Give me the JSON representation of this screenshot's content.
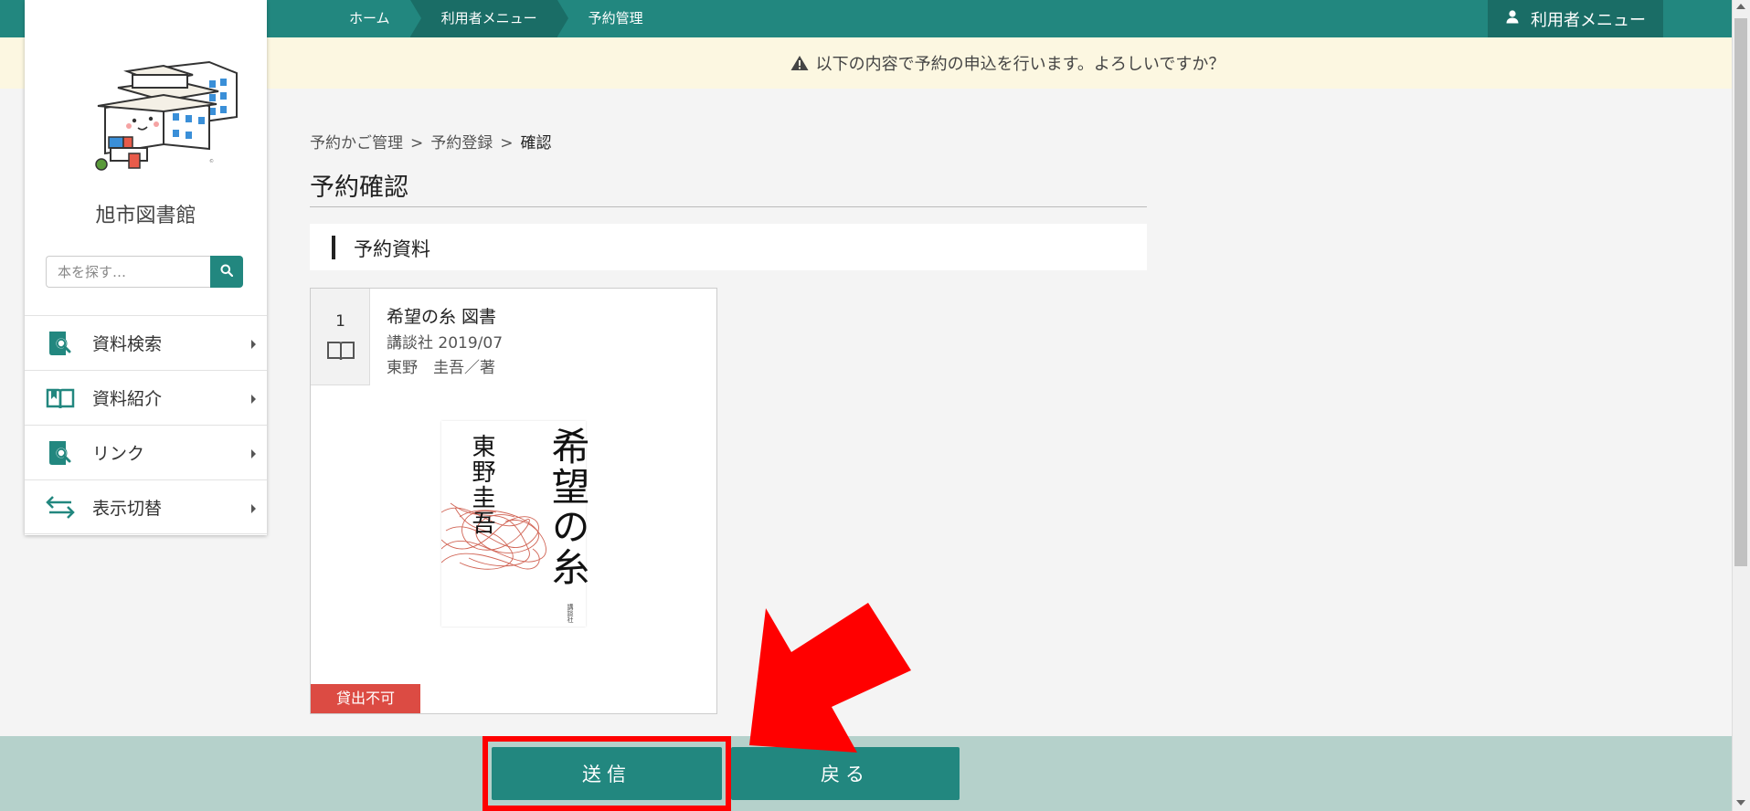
{
  "topbar": {
    "breadcrumbs": [
      "ホーム",
      "利用者メニュー",
      "予約管理"
    ],
    "user_menu_label": "利用者メニュー"
  },
  "notice": {
    "text": "以下の内容で予約の申込を行います。よろしいですか？"
  },
  "sidebar": {
    "library_name": "旭市図書館",
    "search_placeholder": "本を探す…",
    "items": [
      {
        "label": "資料検索",
        "icon": "search-book-icon"
      },
      {
        "label": "資料紹介",
        "icon": "open-book-icon"
      },
      {
        "label": "リンク",
        "icon": "search-book-icon"
      },
      {
        "label": "表示切替",
        "icon": "swap-arrows-icon"
      }
    ]
  },
  "main": {
    "path": [
      "予約かご管理",
      "予約登録",
      "確認"
    ],
    "path_separator": ">",
    "title": "予約確認",
    "section_label": "予約資料",
    "book": {
      "number": "1",
      "title": "希望の糸 図書",
      "publisher_date": "講談社 2019/07",
      "author": "東野　圭吾／著",
      "cover_author": "東野圭吾",
      "cover_title": "希望の糸",
      "cover_publisher": "講談社",
      "status": "貸出不可"
    }
  },
  "footer": {
    "send_label": "送信",
    "back_label": "戻る"
  },
  "colors": {
    "primary": "#22877f",
    "primary_dark": "#1a6d66",
    "notice_bg": "#fcf7e1",
    "status_red": "#dc4b43",
    "highlight_red": "#ff0000",
    "footer_bg": "#b5d1cb"
  }
}
